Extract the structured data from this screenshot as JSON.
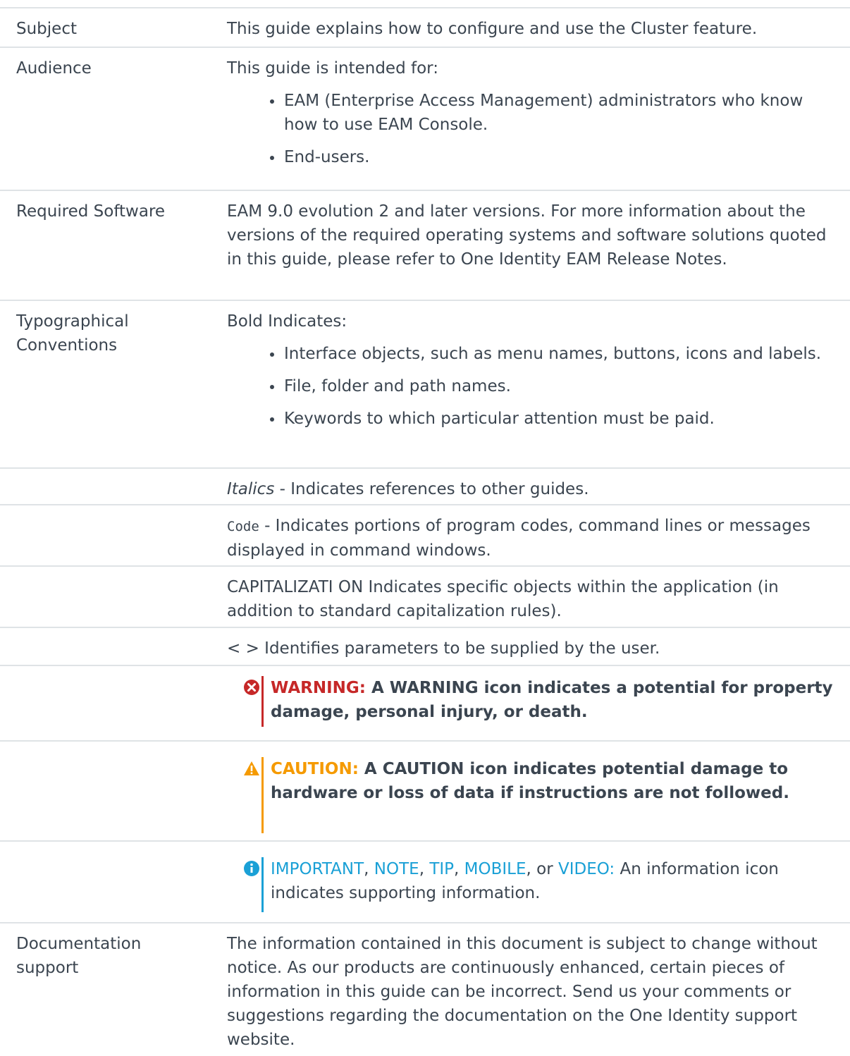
{
  "rows": {
    "subject": {
      "label": "Subject",
      "text": "This guide explains how to configure and use the Cluster feature."
    },
    "audience": {
      "label": "Audience",
      "intro": "This guide is intended for:",
      "items": [
        "EAM (Enterprise Access Management) administrators who know how to use EAM Console.",
        "End-users."
      ]
    },
    "software": {
      "label": "Required Software",
      "text": "EAM 9.0 evolution 2 and later versions. For more information about the versions of the required operating systems and software solutions quoted in this guide, please refer to One Identity EAM Release Notes."
    },
    "typo": {
      "label": "Typographical Conventions",
      "intro": "Bold Indicates:",
      "items": [
        "Interface objects, such as menu names, buttons, icons and labels.",
        "File, folder and path names.",
        "Keywords to which particular attention must be paid."
      ]
    },
    "italics": {
      "term": "Italics",
      "text": " - Indicates references to other guides."
    },
    "code": {
      "term": "Code",
      "text": " - Indicates portions of program codes, command lines or messages displayed in command windows."
    },
    "caps": {
      "text": "CAPITALIZATI ON Indicates specific objects within the application (in addition to standard capitalization rules)."
    },
    "params": {
      "text": "< > Identifies parameters to be supplied by the user."
    },
    "warning": {
      "label": "WARNING:",
      "text": " A WARNING icon indicates a potential for property damage, personal injury, or death.",
      "icon": "error-circle-icon",
      "color": "#c62828"
    },
    "caution": {
      "label": "CAUTION:",
      "text": " A CAUTION icon indicates potential damage to hardware or loss of data if instructions are not followed.",
      "icon": "warning-triangle-icon",
      "color": "#f59a00"
    },
    "info": {
      "labels": [
        "IMPORTANT",
        "NOTE",
        "TIP",
        "MOBILE",
        "VIDEO:"
      ],
      "seps": [
        ", ",
        ", ",
        ", ",
        ", or "
      ],
      "text": " An information icon indicates supporting information.",
      "icon": "info-circle-icon",
      "color": "#1aa0d6"
    },
    "docsupport": {
      "label": "Documentation support",
      "text": "The information contained in this document is subject to change without notice. As our products are continuously enhanced, certain pieces of information in this guide can be incorrect. Send us your comments or suggestions regarding the documentation on the One Identity support website."
    }
  }
}
